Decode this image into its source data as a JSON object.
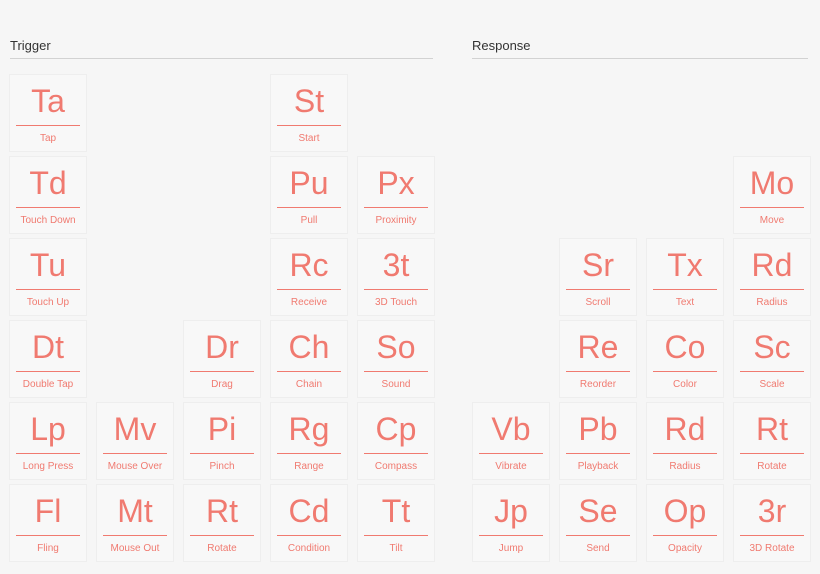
{
  "sections": {
    "trigger": {
      "label": "Trigger"
    },
    "response": {
      "label": "Response"
    }
  },
  "accent": "#f07a70",
  "trigger_tiles": [
    {
      "sym": "Ta",
      "name": "Tap",
      "col": 0,
      "row": 0
    },
    {
      "sym": "St",
      "name": "Start",
      "col": 3,
      "row": 0
    },
    {
      "sym": "Td",
      "name": "Touch Down",
      "col": 0,
      "row": 1
    },
    {
      "sym": "Pu",
      "name": "Pull",
      "col": 3,
      "row": 1
    },
    {
      "sym": "Px",
      "name": "Proximity",
      "col": 4,
      "row": 1
    },
    {
      "sym": "Tu",
      "name": "Touch Up",
      "col": 0,
      "row": 2
    },
    {
      "sym": "Rc",
      "name": "Receive",
      "col": 3,
      "row": 2
    },
    {
      "sym": "3t",
      "name": "3D Touch",
      "col": 4,
      "row": 2
    },
    {
      "sym": "Dt",
      "name": "Double Tap",
      "col": 0,
      "row": 3
    },
    {
      "sym": "Dr",
      "name": "Drag",
      "col": 2,
      "row": 3
    },
    {
      "sym": "Ch",
      "name": "Chain",
      "col": 3,
      "row": 3
    },
    {
      "sym": "So",
      "name": "Sound",
      "col": 4,
      "row": 3
    },
    {
      "sym": "Lp",
      "name": "Long Press",
      "col": 0,
      "row": 4
    },
    {
      "sym": "Mv",
      "name": "Mouse Over",
      "col": 1,
      "row": 4
    },
    {
      "sym": "Pi",
      "name": "Pinch",
      "col": 2,
      "row": 4
    },
    {
      "sym": "Rg",
      "name": "Range",
      "col": 3,
      "row": 4
    },
    {
      "sym": "Cp",
      "name": "Compass",
      "col": 4,
      "row": 4
    },
    {
      "sym": "Fl",
      "name": "Fling",
      "col": 0,
      "row": 5
    },
    {
      "sym": "Mt",
      "name": "Mouse Out",
      "col": 1,
      "row": 5
    },
    {
      "sym": "Rt",
      "name": "Rotate",
      "col": 2,
      "row": 5
    },
    {
      "sym": "Cd",
      "name": "Condition",
      "col": 3,
      "row": 5
    },
    {
      "sym": "Tt",
      "name": "Tilt",
      "col": 4,
      "row": 5
    }
  ],
  "response_tiles": [
    {
      "sym": "Mo",
      "name": "Move",
      "col": 3,
      "row": 1
    },
    {
      "sym": "Sr",
      "name": "Scroll",
      "col": 1,
      "row": 2
    },
    {
      "sym": "Tx",
      "name": "Text",
      "col": 2,
      "row": 2
    },
    {
      "sym": "Rd",
      "name": "Radius",
      "col": 3,
      "row": 2
    },
    {
      "sym": "Re",
      "name": "Reorder",
      "col": 1,
      "row": 3
    },
    {
      "sym": "Co",
      "name": "Color",
      "col": 2,
      "row": 3
    },
    {
      "sym": "Sc",
      "name": "Scale",
      "col": 3,
      "row": 3
    },
    {
      "sym": "Vb",
      "name": "Vibrate",
      "col": 0,
      "row": 4
    },
    {
      "sym": "Pb",
      "name": "Playback",
      "col": 1,
      "row": 4
    },
    {
      "sym": "Rd",
      "name": "Radius",
      "col": 2,
      "row": 4
    },
    {
      "sym": "Rt",
      "name": "Rotate",
      "col": 3,
      "row": 4
    },
    {
      "sym": "Jp",
      "name": "Jump",
      "col": 0,
      "row": 5
    },
    {
      "sym": "Se",
      "name": "Send",
      "col": 1,
      "row": 5
    },
    {
      "sym": "Op",
      "name": "Opacity",
      "col": 2,
      "row": 5
    },
    {
      "sym": "3r",
      "name": "3D Rotate",
      "col": 3,
      "row": 5
    }
  ]
}
